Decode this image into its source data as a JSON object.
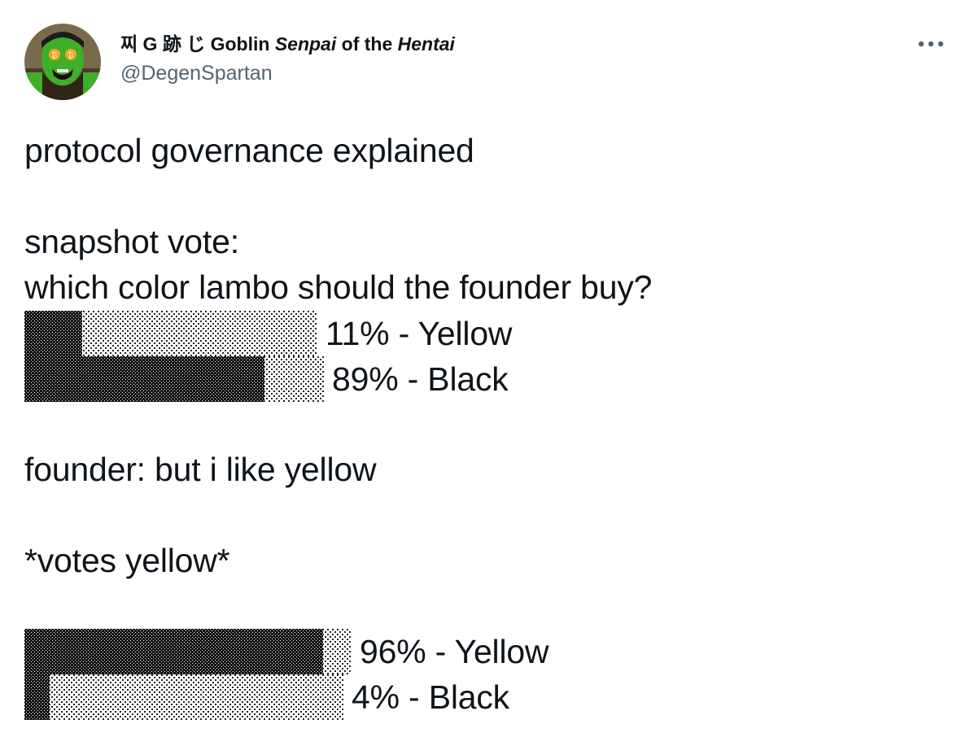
{
  "tweet": {
    "display_name_prefix": "찌 G 跡 じ Goblin ",
    "display_name_senpai": "Senpai",
    "display_name_mid": " of the ",
    "display_name_hentai": "Hentai",
    "handle": "@DegenSpartan",
    "more_icon": "more-horizontal-icon",
    "lines": [
      "protocol governance explained",
      "snapshot vote:",
      "which color lambo should the founder buy?",
      "founder: but i like yellow",
      "*votes yellow*"
    ],
    "poll_before": {
      "yellow_label": "11% - Yellow",
      "black_label": "89% - Black",
      "yellow_fraction": 0.11,
      "black_fraction": 0.89
    },
    "poll_after": {
      "yellow_label": "96% - Yellow",
      "black_label": "4% - Black",
      "yellow_fraction": 0.96,
      "black_fraction": 0.04
    }
  },
  "colors": {
    "text": "#0f1419",
    "handle": "#536471",
    "avatar_skin": "#3fae2a"
  }
}
